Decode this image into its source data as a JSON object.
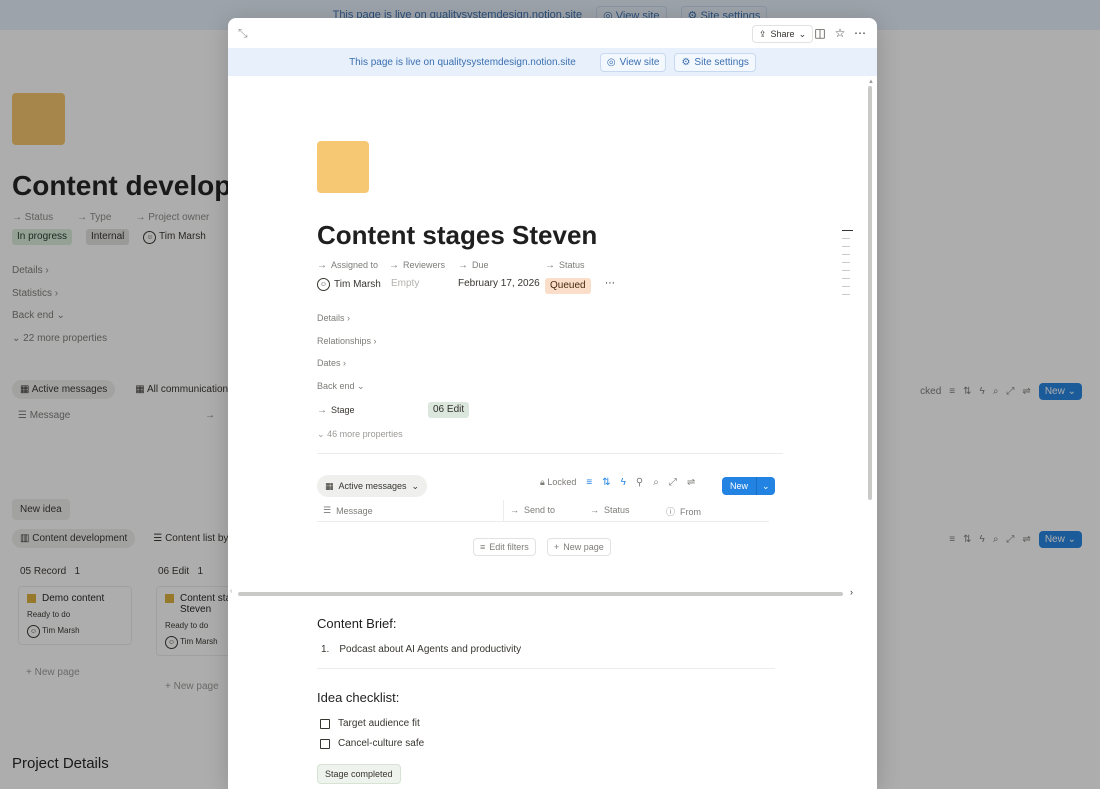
{
  "background": {
    "banner_text": "This page is live on qualitysystemdesign.notion.site",
    "view_site": "View site",
    "site_settings": "Site settings",
    "title": "Content development",
    "prop_names": [
      "Status",
      "Type",
      "Project owner"
    ],
    "status": "In progress",
    "type": "Internal",
    "owner": "Tim Marsh",
    "sections": [
      "Details",
      "Statistics",
      "Back end",
      "22 more properties"
    ],
    "tabs": [
      "Active messages",
      "All communication"
    ],
    "col_message": "Message",
    "toolbar_text": "cked",
    "new_label": "New",
    "new_idea": "New idea",
    "board_tabs": [
      "Content development",
      "Content list by s"
    ],
    "groups": [
      {
        "name": "05 Record",
        "count": "1"
      },
      {
        "name": "06 Edit",
        "count": "1"
      }
    ],
    "cards": [
      {
        "name": "Demo content",
        "status": "Ready to do",
        "owner": "Tim Marsh"
      },
      {
        "name": "Content stages Steven",
        "status": "Ready to do",
        "owner": "Tim Marsh"
      }
    ],
    "new_page": "New page",
    "project_details": "Project Details"
  },
  "modal": {
    "share_label": "Share",
    "banner": {
      "text": "This page is live on qualitysystemdesign.notion.site",
      "view_site": "View site",
      "site_settings": "Site settings"
    },
    "title": "Content stages Steven",
    "properties": {
      "assigned_to": {
        "name": "Assigned to",
        "value": "Tim Marsh"
      },
      "reviewers": {
        "name": "Reviewers",
        "value": "Empty"
      },
      "due": {
        "name": "Due",
        "value": "February 17, 2026"
      },
      "status": {
        "name": "Status",
        "value": "Queued"
      }
    },
    "sections": [
      "Details",
      "Relationships",
      "Dates",
      "Back end"
    ],
    "stage": {
      "name": "Stage",
      "value": "06 Edit"
    },
    "more_properties": "46 more properties",
    "database": {
      "view_label": "Active messages",
      "locked_label": "Locked",
      "new_label": "New",
      "columns": [
        "Message",
        "Send to",
        "Status",
        "From"
      ],
      "edit_filters": "Edit filters",
      "new_page": "New page"
    },
    "content_brief": {
      "heading": "Content Brief:",
      "items": [
        "Podcast about AI Agents and productivity"
      ]
    },
    "idea_checklist": {
      "heading": "Idea checklist:",
      "items": [
        "Target audience fit",
        "Cancel-culture safe"
      ]
    },
    "stage_button": "Stage completed"
  }
}
